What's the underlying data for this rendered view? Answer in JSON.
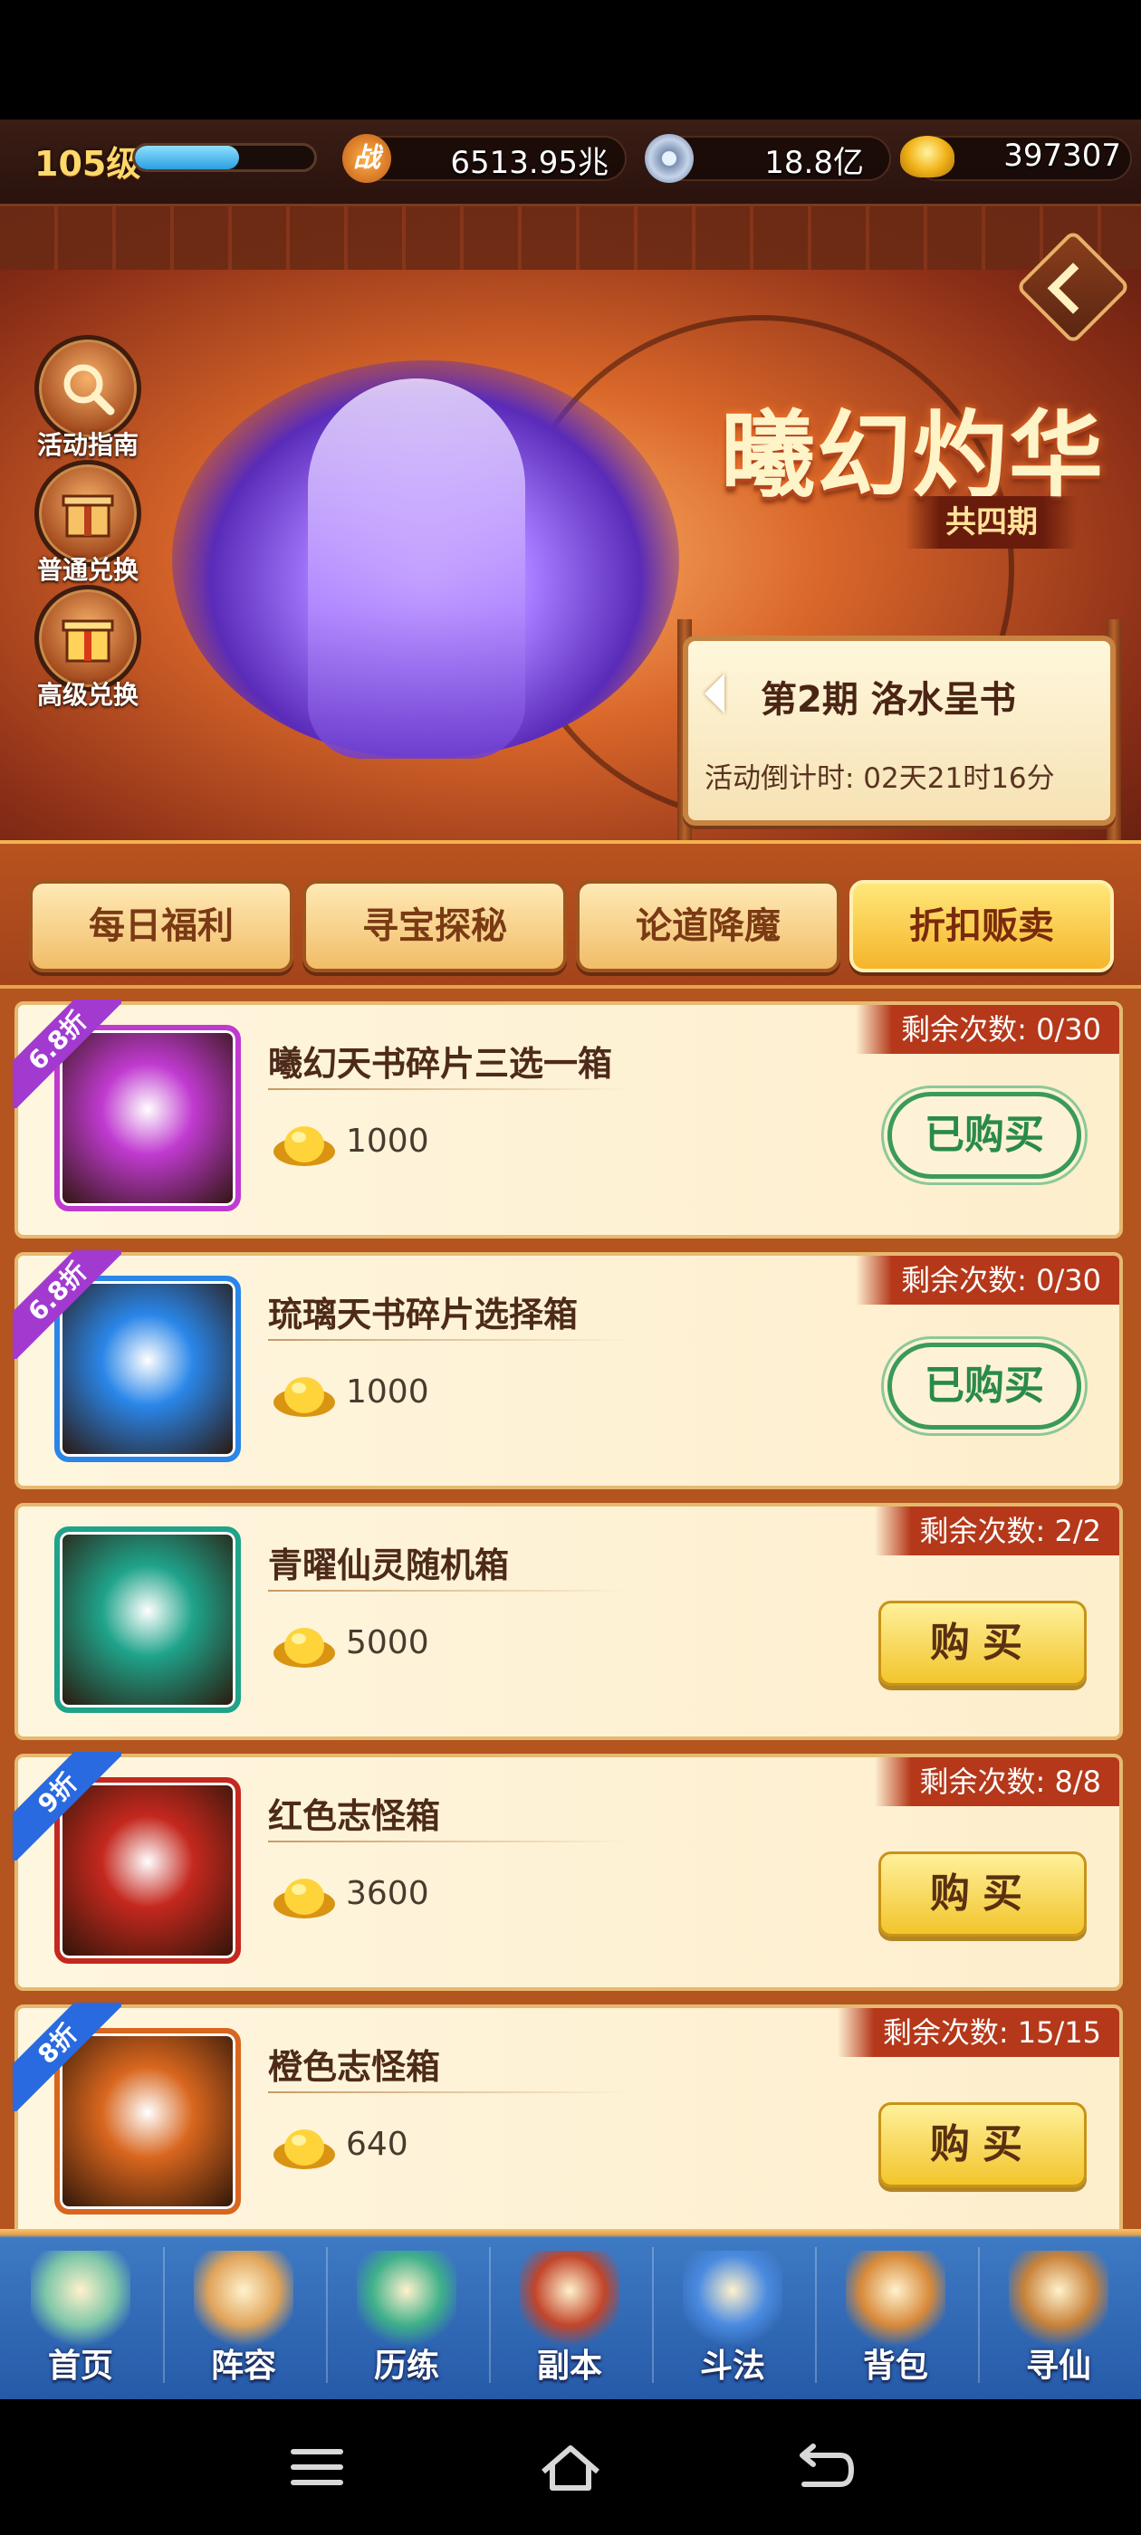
{
  "topbar": {
    "level": "105级",
    "level_progress": 0.58,
    "battle_icon": "战",
    "power": "6513.95兆",
    "silver": "18.8亿",
    "gold": "397307"
  },
  "banner": {
    "title": "曦幻灼华",
    "subtitle": "共四期",
    "period": "第2期  洛水呈书",
    "countdown": "活动倒计时: 02天21时16分",
    "side_buttons": [
      {
        "label": "活动指南",
        "icon": "magnifier-icon"
      },
      {
        "label": "普通兑换",
        "icon": "gift-box-icon"
      },
      {
        "label": "高级兑换",
        "icon": "gift-box-icon"
      }
    ]
  },
  "tabs": [
    "每日福利",
    "寻宝探秘",
    "论道降魔",
    "折扣贩卖"
  ],
  "active_tab": 3,
  "items": [
    {
      "name": "曦幻天书碎片三选一箱",
      "price": "1000",
      "remaining": "剩余次数: 0/30",
      "discount": "6.8折",
      "button": "已购买",
      "bought": true,
      "color": "#c03ad0"
    },
    {
      "name": "琉璃天书碎片选择箱",
      "price": "1000",
      "remaining": "剩余次数: 0/30",
      "discount": "6.8折",
      "button": "已购买",
      "bought": true,
      "color": "#2a86e8"
    },
    {
      "name": "青曜仙灵随机箱",
      "price": "5000",
      "remaining": "剩余次数: 2/2",
      "discount": "",
      "button": "购买",
      "bought": false,
      "color": "#1fa38a"
    },
    {
      "name": "红色志怪箱",
      "price": "3600",
      "remaining": "剩余次数: 8/8",
      "discount": "9折",
      "button": "购买",
      "bought": false,
      "color": "#c4281e"
    },
    {
      "name": "橙色志怪箱",
      "price": "640",
      "remaining": "剩余次数: 15/15",
      "discount": "8折",
      "button": "购买",
      "bought": false,
      "color": "#d8661e"
    }
  ],
  "bottom_nav": [
    {
      "label": "首页",
      "icon": "home-mountain-icon"
    },
    {
      "label": "阵容",
      "icon": "cards-icon"
    },
    {
      "label": "历练",
      "icon": "gourd-icon"
    },
    {
      "label": "副本",
      "icon": "gate-icon"
    },
    {
      "label": "斗法",
      "icon": "sword-icon"
    },
    {
      "label": "背包",
      "icon": "bag-icon"
    },
    {
      "label": "寻仙",
      "icon": "scroll-eye-icon"
    }
  ],
  "colors": {
    "accent": "#f5b52a",
    "bought": "#2a8a4a",
    "remaining_badge": "#b5381a",
    "nav_blue": "#265aa8"
  }
}
